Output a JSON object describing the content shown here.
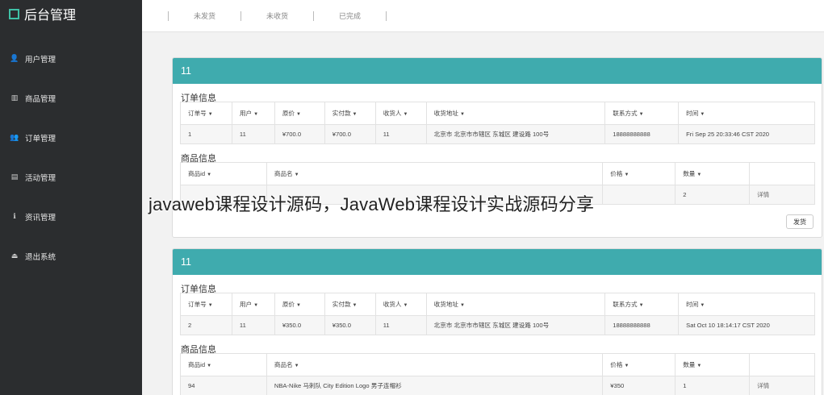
{
  "sidebar": {
    "title": "后台管理",
    "items": [
      {
        "label": "用户管理",
        "icon": "user-icon",
        "glyph": "👤"
      },
      {
        "label": "商品管理",
        "icon": "bar-chart-icon",
        "glyph": "▥"
      },
      {
        "label": "订单管理",
        "icon": "users-icon",
        "glyph": "👥"
      },
      {
        "label": "活动管理",
        "icon": "database-icon",
        "glyph": "▤"
      },
      {
        "label": "资讯管理",
        "icon": "info-icon",
        "glyph": "ℹ"
      },
      {
        "label": "退出系统",
        "icon": "eject-icon",
        "glyph": "⏏"
      }
    ]
  },
  "topbar": {
    "tabs": [
      "未发货",
      "未收货",
      "已完成"
    ]
  },
  "order_section_title": "订单信息",
  "goods_section_title": "商品信息",
  "order_headers": [
    "订单号",
    "用户",
    "原价",
    "实付款",
    "收货人",
    "收货地址",
    "联系方式",
    "时间"
  ],
  "goods_headers": [
    "商品id",
    "商品名",
    "价格",
    "数量",
    ""
  ],
  "orders": [
    {
      "panel_title": "11",
      "order": [
        "1",
        "11",
        "¥700.0",
        "¥700.0",
        "11",
        "北京市 北京市市辖区 东城区 建设路 100号",
        "18888888888",
        "Fri Sep 25 20:33:46 CST 2020"
      ],
      "goods": [
        "",
        "",
        "",
        "2",
        "详情"
      ],
      "ship_label": "发货"
    },
    {
      "panel_title": "11",
      "order": [
        "2",
        "11",
        "¥350.0",
        "¥350.0",
        "11",
        "北京市 北京市市辖区 东城区 建设路 100号",
        "18888888888",
        "Sat Oct 10 18:14:17 CST 2020"
      ],
      "goods": [
        "94",
        "NBA-Nike 马刺队 City Edition Logo 男子连帽衫",
        "¥350",
        "1",
        "详情"
      ]
    }
  ],
  "watermark": "javaweb课程设计源码，JavaWeb课程设计实战源码分享"
}
